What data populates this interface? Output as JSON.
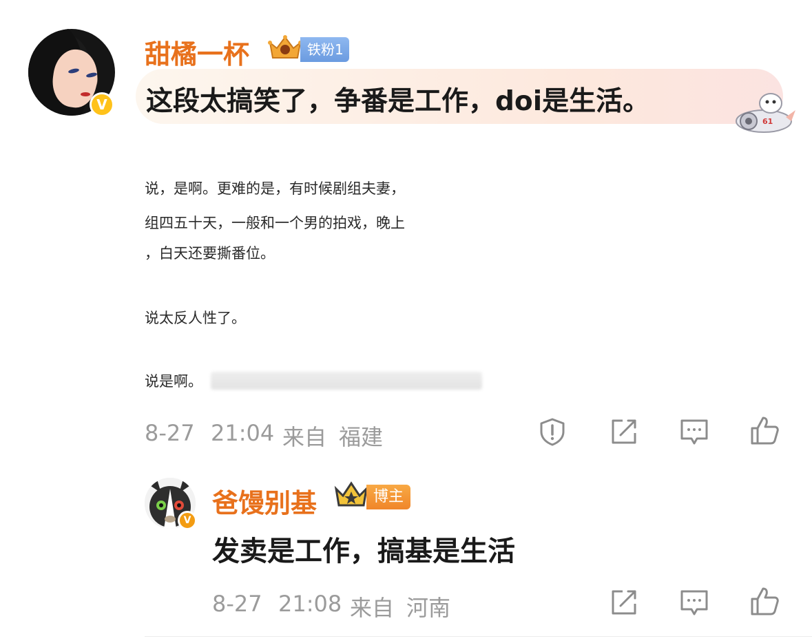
{
  "main_comment": {
    "username": "甜橘一杯",
    "fan_badge": "铁粉1",
    "verified_mark": "V",
    "text": "这段太搞笑了，争番是工作，doi是生活。",
    "quoted_lines": [
      "说，是啊。更难的是，有时候剧组夫妻，",
      "组四五十天，一般和一个男的拍戏，晚上",
      "，白天还要撕番位。",
      "说太反人性了。",
      "说是啊。"
    ],
    "date": "8-27",
    "time": "21:04",
    "source_prefix": "来自",
    "location": "福建",
    "actions": [
      "report-icon",
      "repost-icon",
      "comment-icon",
      "like-icon"
    ]
  },
  "reply": {
    "username": "爸馒别基",
    "role_badge": "博主",
    "verified_mark": "V",
    "text": "发卖是工作，搞基是生活",
    "date": "8-27",
    "time": "21:08",
    "source_prefix": "来自",
    "location": "河南",
    "actions": [
      "repost-icon",
      "comment-icon",
      "like-icon"
    ]
  },
  "colors": {
    "username": "#e8711c",
    "meta": "#9b9b9b",
    "icon": "#8c8c8c",
    "verified": "#ffc21a"
  }
}
